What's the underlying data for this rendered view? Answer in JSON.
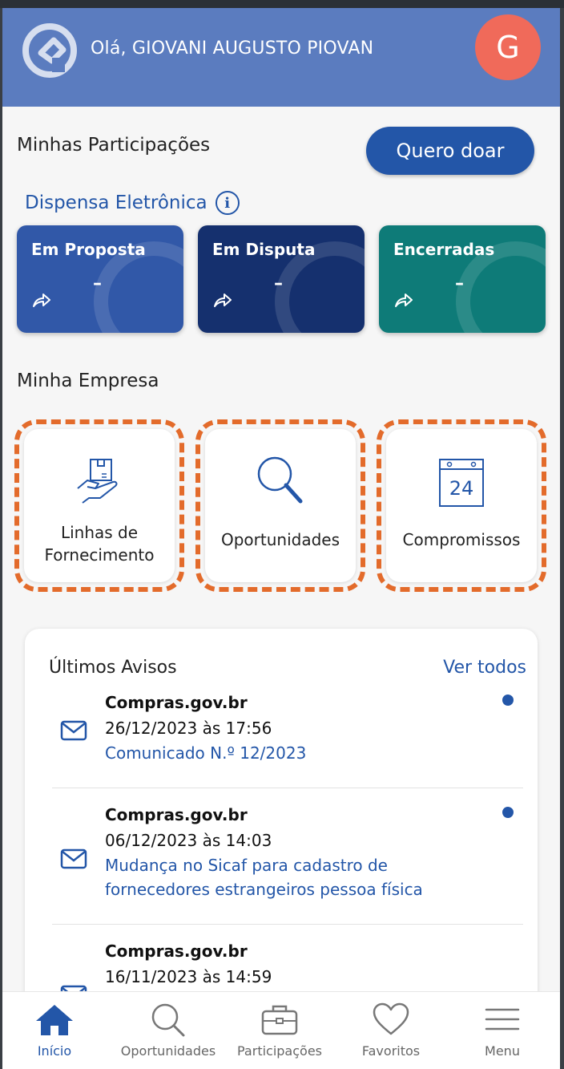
{
  "header": {
    "greeting": "Olá, GIOVANI AUGUSTO PIOVAN",
    "avatar_letter": "G"
  },
  "participacoes": {
    "title": "Minhas Participações",
    "donate_label": "Quero doar",
    "dispensa_label": "Dispensa Eletrônica",
    "cards": [
      {
        "label": "Em Proposta",
        "value": "–",
        "color": "#3158a8"
      },
      {
        "label": "Em Disputa",
        "value": "–",
        "color": "#15306e"
      },
      {
        "label": "Encerradas",
        "value": "–",
        "color": "#0e7b78"
      }
    ]
  },
  "empresa": {
    "title": "Minha Empresa",
    "tiles": [
      {
        "line1": "Linhas de",
        "line2": "Fornecimento",
        "icon": "hand-box-icon"
      },
      {
        "line1": "Oportunidades",
        "line2": "",
        "icon": "magnifier-icon"
      },
      {
        "line1": "Compromissos",
        "line2": "",
        "icon": "calendar-icon",
        "calendar_day": "24"
      }
    ]
  },
  "avisos": {
    "title": "Últimos Avisos",
    "see_all": "Ver todos",
    "items": [
      {
        "source": "Compras.gov.br",
        "date": "26/12/2023 às 17:56",
        "subject": "Comunicado N.º 12/2023",
        "unread": true
      },
      {
        "source": "Compras.gov.br",
        "date": "06/12/2023 às 14:03",
        "subject": "Mudança no Sicaf para cadastro de fornecedores estrangeiros pessoa física",
        "unread": true
      },
      {
        "source": "Compras.gov.br",
        "date": "16/11/2023 às 14:59",
        "subject": "",
        "unread": false
      }
    ]
  },
  "bottom_nav": [
    {
      "label": "Início",
      "icon": "home-icon",
      "active": true
    },
    {
      "label": "Oportunidades",
      "icon": "search-icon",
      "active": false
    },
    {
      "label": "Participações",
      "icon": "briefcase-icon",
      "active": false
    },
    {
      "label": "Favoritos",
      "icon": "heart-icon",
      "active": false
    },
    {
      "label": "Menu",
      "icon": "menu-icon",
      "active": false
    }
  ],
  "colors": {
    "header": "#5b7cbf",
    "primary": "#2356a8",
    "highlight_dash": "#e36b2b",
    "avatar": "#f06a5a"
  }
}
